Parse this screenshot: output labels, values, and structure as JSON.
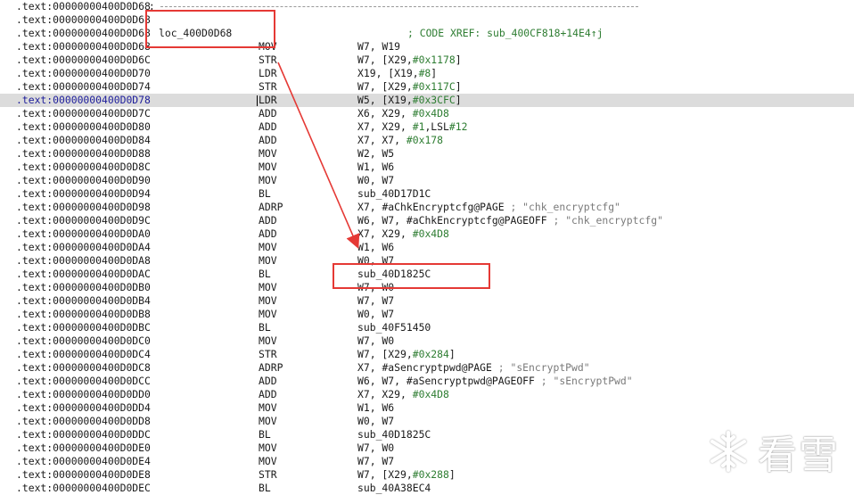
{
  "listing": {
    "rows": [
      {
        "addr": ".text:00000000400D0D68",
        "type": "sep",
        "text": " ;"
      },
      {
        "addr": ".text:00000000400D0D68",
        "type": "blank"
      },
      {
        "addr": ".text:00000000400D0D68",
        "type": "label",
        "label": "loc_400D0D68",
        "comment": "; CODE XREF: sub_400CF818+14E4↑j"
      },
      {
        "addr": ".text:00000000400D0D68",
        "type": "ins",
        "mnem": "MOV",
        "ops": "W7, W19"
      },
      {
        "addr": ".text:00000000400D0D6C",
        "type": "ins",
        "mnem": "STR",
        "ops": "W7, [X29,#0x1178]"
      },
      {
        "addr": ".text:00000000400D0D70",
        "type": "ins",
        "mnem": "LDR",
        "ops": "X19, [X19,#8]"
      },
      {
        "addr": ".text:00000000400D0D74",
        "type": "ins",
        "mnem": "STR",
        "ops": "W7, [X29,#0x117C]"
      },
      {
        "addr": ".text:00000000400D0D78",
        "type": "ins",
        "mnem": "LDR",
        "ops": "W5, [X19,#0x3CFC]",
        "highlight": true
      },
      {
        "addr": ".text:00000000400D0D7C",
        "type": "ins",
        "mnem": "ADD",
        "ops": "X6, X29, #0x4D8"
      },
      {
        "addr": ".text:00000000400D0D80",
        "type": "ins",
        "mnem": "ADD",
        "ops": "X7, X29, #1,LSL#12"
      },
      {
        "addr": ".text:00000000400D0D84",
        "type": "ins",
        "mnem": "ADD",
        "ops": "X7, X7, #0x178"
      },
      {
        "addr": ".text:00000000400D0D88",
        "type": "ins",
        "mnem": "MOV",
        "ops": "W2, W5"
      },
      {
        "addr": ".text:00000000400D0D8C",
        "type": "ins",
        "mnem": "MOV",
        "ops": "W1, W6"
      },
      {
        "addr": ".text:00000000400D0D90",
        "type": "ins",
        "mnem": "MOV",
        "ops": "W0, W7"
      },
      {
        "addr": ".text:00000000400D0D94",
        "type": "ins",
        "mnem": "BL",
        "ops": "sub_40D17D1C"
      },
      {
        "addr": ".text:00000000400D0D98",
        "type": "ins",
        "mnem": "ADRP",
        "ops": "X7, #aChkEncryptcfg@PAGE",
        "icomment": "; \"chk_encryptcfg\""
      },
      {
        "addr": ".text:00000000400D0D9C",
        "type": "ins",
        "mnem": "ADD",
        "ops": "W6, W7, #aChkEncryptcfg@PAGEOFF",
        "icomment": "; \"chk_encryptcfg\""
      },
      {
        "addr": ".text:00000000400D0DA0",
        "type": "ins",
        "mnem": "ADD",
        "ops": "X7, X29, #0x4D8"
      },
      {
        "addr": ".text:00000000400D0DA4",
        "type": "ins",
        "mnem": "MOV",
        "ops": "W1, W6"
      },
      {
        "addr": ".text:00000000400D0DA8",
        "type": "ins",
        "mnem": "MOV",
        "ops": "W0, W7"
      },
      {
        "addr": ".text:00000000400D0DAC",
        "type": "ins",
        "mnem": "BL",
        "ops": "sub_40D1825C"
      },
      {
        "addr": ".text:00000000400D0DB0",
        "type": "ins",
        "mnem": "MOV",
        "ops": "W7, W0"
      },
      {
        "addr": ".text:00000000400D0DB4",
        "type": "ins",
        "mnem": "MOV",
        "ops": "W7, W7"
      },
      {
        "addr": ".text:00000000400D0DB8",
        "type": "ins",
        "mnem": "MOV",
        "ops": "W0, W7"
      },
      {
        "addr": ".text:00000000400D0DBC",
        "type": "ins",
        "mnem": "BL",
        "ops": "sub_40F51450"
      },
      {
        "addr": ".text:00000000400D0DC0",
        "type": "ins",
        "mnem": "MOV",
        "ops": "W7, W0"
      },
      {
        "addr": ".text:00000000400D0DC4",
        "type": "ins",
        "mnem": "STR",
        "ops": "W7, [X29,#0x284]"
      },
      {
        "addr": ".text:00000000400D0DC8",
        "type": "ins",
        "mnem": "ADRP",
        "ops": "X7, #aSencryptpwd@PAGE",
        "icomment": "; \"sEncryptPwd\""
      },
      {
        "addr": ".text:00000000400D0DCC",
        "type": "ins",
        "mnem": "ADD",
        "ops": "W6, W7, #aSencryptpwd@PAGEOFF",
        "icomment": "; \"sEncryptPwd\""
      },
      {
        "addr": ".text:00000000400D0DD0",
        "type": "ins",
        "mnem": "ADD",
        "ops": "X7, X29, #0x4D8"
      },
      {
        "addr": ".text:00000000400D0DD4",
        "type": "ins",
        "mnem": "MOV",
        "ops": "W1, W6"
      },
      {
        "addr": ".text:00000000400D0DD8",
        "type": "ins",
        "mnem": "MOV",
        "ops": "W0, W7"
      },
      {
        "addr": ".text:00000000400D0DDC",
        "type": "ins",
        "mnem": "BL",
        "ops": "sub_40D1825C"
      },
      {
        "addr": ".text:00000000400D0DE0",
        "type": "ins",
        "mnem": "MOV",
        "ops": "W7, W0"
      },
      {
        "addr": ".text:00000000400D0DE4",
        "type": "ins",
        "mnem": "MOV",
        "ops": "W7, W7"
      },
      {
        "addr": ".text:00000000400D0DE8",
        "type": "ins",
        "mnem": "STR",
        "ops": "W7, [X29,#0x288]"
      },
      {
        "addr": ".text:00000000400D0DEC",
        "type": "ins",
        "mnem": "BL",
        "ops": "sub_40A38EC4"
      }
    ]
  },
  "annotations": {
    "color": "#e53935",
    "label_box_target": "loc_400D0D68",
    "call_box_target": "sub_40D1825C"
  },
  "watermark": {
    "text": "看雪",
    "icon": "snowflake-icon"
  },
  "colors": {
    "immediate": "#2e7d32",
    "comment": "#2e7d32",
    "highlight_row": "#dcdcdc"
  }
}
